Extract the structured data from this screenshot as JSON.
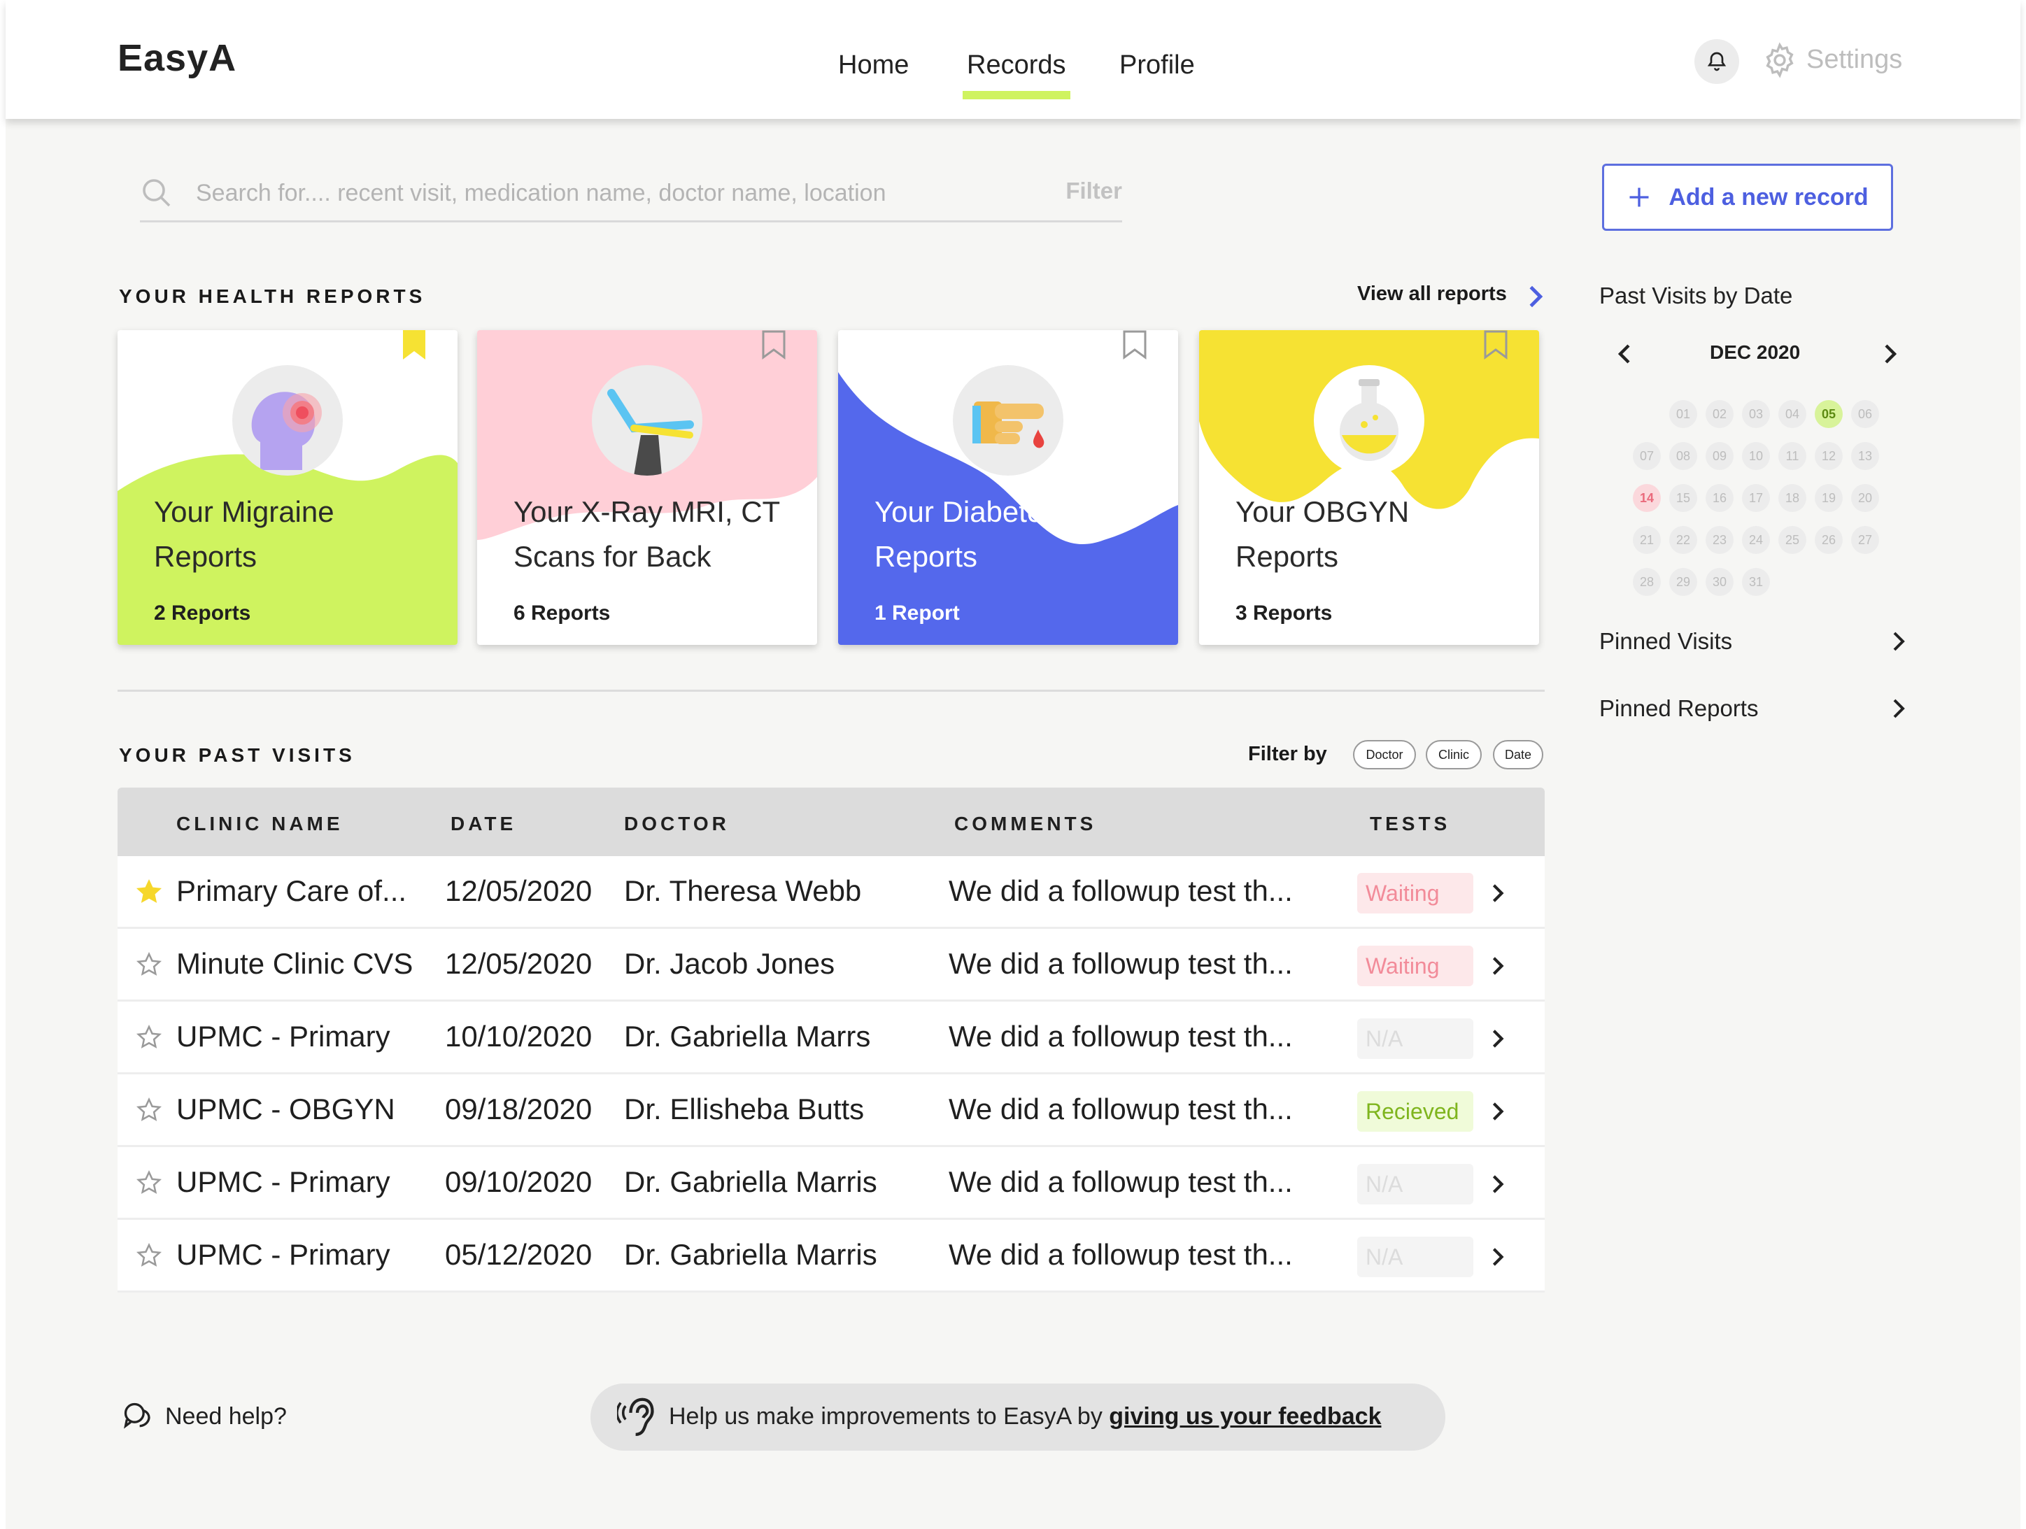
{
  "app": {
    "name": "EasyA"
  },
  "nav": {
    "items": [
      {
        "label": "Home"
      },
      {
        "label": "Records"
      },
      {
        "label": "Profile"
      }
    ],
    "active": "Records"
  },
  "header": {
    "settings_label": "Settings",
    "icons": [
      "bell-icon",
      "gear-icon"
    ]
  },
  "search": {
    "placeholder": "Search for.... recent visit, medication name, doctor name, location",
    "value": "",
    "filter_label": "Filter"
  },
  "add_record": {
    "label": "Add a new record",
    "icon": "plus-icon"
  },
  "health_reports": {
    "title": "YOUR HEALTH REPORTS",
    "view_all": "View all reports",
    "cards": [
      {
        "title_line1": "Your Migraine",
        "title_line2": "Reports",
        "count": "2 Reports",
        "color": "#cff35f",
        "icon": "migraine-head-icon",
        "bookmarked": true
      },
      {
        "title_line1": "Your X-Ray MRI, CT",
        "title_line2": "Scans for Back",
        "count": "6 Reports",
        "color": "#ffcfd7",
        "icon": "dental-chair-icon",
        "bookmarked": false
      },
      {
        "title_line1": "Your Diabetes",
        "title_line2": "Reports",
        "count": "1 Report",
        "color": "#5468ec",
        "icon": "finger-blood-drop-icon",
        "bookmarked": false
      },
      {
        "title_line1": "Your OBGYN",
        "title_line2": "Reports",
        "count": "3 Reports",
        "color": "#f6e233",
        "icon": "flask-icon",
        "bookmarked": false
      }
    ]
  },
  "past_visits": {
    "title": "YOUR PAST VISITS",
    "filter_by": "Filter by",
    "chips": [
      "Doctor",
      "Clinic",
      "Date"
    ],
    "columns": [
      "CLINIC NAME",
      "DATE",
      "DOCTOR",
      "COMMENTS",
      "TESTS"
    ],
    "rows": [
      {
        "starred": true,
        "clinic": "Primary Care of...",
        "date": "12/05/2020",
        "doctor": "Dr. Theresa Webb",
        "comment": "We did a followup test th...",
        "test": "Waiting",
        "status": "waiting"
      },
      {
        "starred": false,
        "clinic": "Minute Clinic CVS",
        "date": "12/05/2020",
        "doctor": "Dr. Jacob Jones",
        "comment": "We did a followup test th...",
        "test": "Waiting",
        "status": "waiting"
      },
      {
        "starred": false,
        "clinic": "UPMC - Primary",
        "date": "10/10/2020",
        "doctor": "Dr. Gabriella Marrs",
        "comment": "We did a followup test th...",
        "test": "N/A",
        "status": "na"
      },
      {
        "starred": false,
        "clinic": "UPMC - OBGYN",
        "date": "09/18/2020",
        "doctor": "Dr. Ellisheba Butts",
        "comment": "We did a followup test th...",
        "test": "Recieved",
        "status": "rec"
      },
      {
        "starred": false,
        "clinic": "UPMC - Primary",
        "date": "09/10/2020",
        "doctor": "Dr. Gabriella Marris",
        "comment": "We did a followup test th...",
        "test": "N/A",
        "status": "na"
      },
      {
        "starred": false,
        "clinic": "UPMC - Primary",
        "date": "05/12/2020",
        "doctor": "Dr. Gabriella Marris",
        "comment": "We did a followup test th...",
        "test": "N/A",
        "status": "na"
      }
    ]
  },
  "calendar": {
    "title": "Past Visits by Date",
    "month": "DEC 2020",
    "days": [
      "01",
      "02",
      "03",
      "04",
      "05",
      "06",
      "07",
      "08",
      "09",
      "10",
      "11",
      "12",
      "13",
      "14",
      "15",
      "16",
      "17",
      "18",
      "19",
      "20",
      "21",
      "22",
      "23",
      "24",
      "25",
      "26",
      "27",
      "28",
      "29",
      "30",
      "31"
    ],
    "first_weekday_index": 1,
    "selected": "05",
    "highlighted": "14"
  },
  "sidebar_links": [
    {
      "label": "Pinned Visits"
    },
    {
      "label": "Pinned Reports"
    }
  ],
  "footer": {
    "help": "Need help?",
    "feedback_text": "Help us make improvements to EasyA by ",
    "feedback_link": "giving us your feedback"
  }
}
